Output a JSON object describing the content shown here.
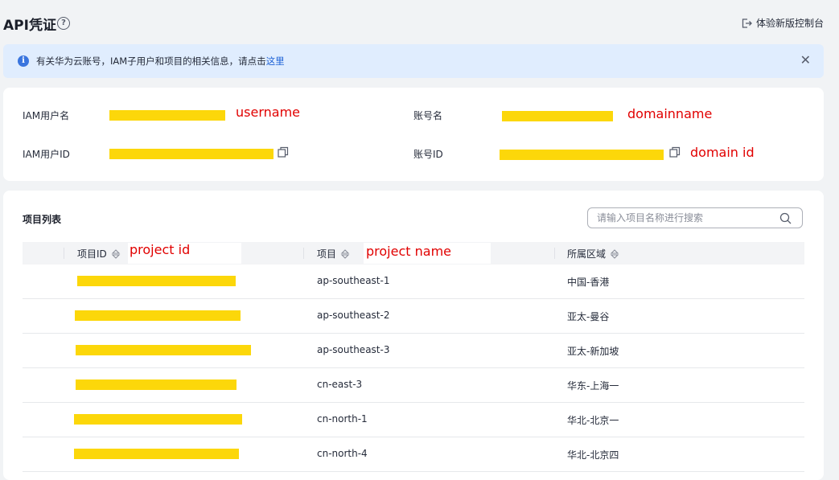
{
  "header": {
    "title": "API凭证",
    "help_icon": "help-circle-icon",
    "new_console_label": "体验新版控制台",
    "new_console_icon": "exit-icon"
  },
  "alert": {
    "text": "有关华为云账号，IAM子用户和项目的相关信息，请点击",
    "link": "这里",
    "info_icon": "info-icon",
    "close_icon": "close-icon"
  },
  "credentials": {
    "iam_user_name_label": "IAM用户名",
    "iam_user_name_annotation": "username",
    "account_name_label": "账号名",
    "account_name_annotation": "domainname",
    "iam_user_id_label": "IAM用户ID",
    "account_id_label": "账号ID",
    "account_id_annotation": "domain id",
    "copy_icon": "copy-icon"
  },
  "projects": {
    "title": "项目列表",
    "search_placeholder": "请输入项目名称进行搜索",
    "columns": [
      {
        "label": "项目ID",
        "annotation": "project id"
      },
      {
        "label": "项目",
        "annotation": "project name"
      },
      {
        "label": "所属区域"
      }
    ],
    "rows": [
      {
        "project": "ap-southeast-1",
        "region": "中国-香港"
      },
      {
        "project": "ap-southeast-2",
        "region": "亚太-曼谷"
      },
      {
        "project": "ap-southeast-3",
        "region": "亚太-新加坡"
      },
      {
        "project": "cn-east-3",
        "region": "华东-上海一"
      },
      {
        "project": "cn-north-1",
        "region": "华北-北京一"
      },
      {
        "project": "cn-north-4",
        "region": "华北-北京四"
      }
    ]
  },
  "colors": {
    "redaction": "#fcd70a",
    "annotation": "#e10000",
    "link": "#1e62d6",
    "alert_bg": "#e0edfe"
  }
}
